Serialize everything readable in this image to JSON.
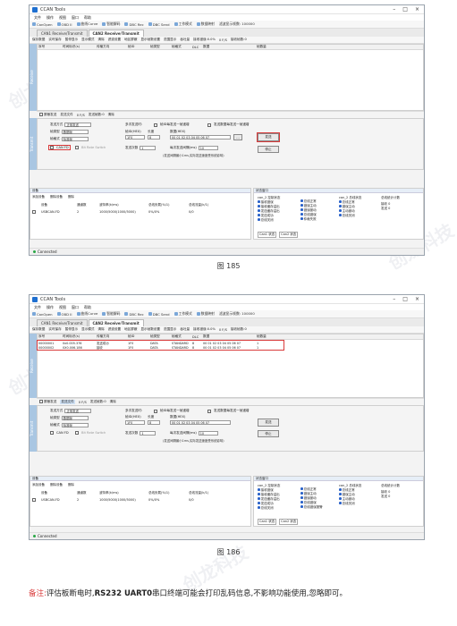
{
  "app": {
    "title": "CCAN Tools",
    "menu": [
      "文件",
      "操作",
      "视图",
      "窗口",
      "帮助"
    ],
    "toolbar": [
      "CanOpen",
      "OBD II",
      "曲线Curve",
      "智能解码",
      "DBC Rec",
      "DBC Send",
      "工作模式",
      "数据映射",
      "滤波显示帧数: 100000"
    ],
    "tabs": [
      "CAN1 Receive/Transmit",
      "CAN2 Receive/Transmit"
    ],
    "subtool": [
      "保存数据",
      "实时保存",
      "暂停显示",
      "显示模式",
      "清除",
      "滤波设置",
      "地区屏蔽",
      "显示帧数设置",
      "范围显示",
      "吞吐量",
      "数据移动",
      "接收错误:0.0%",
      "0 F/S",
      "接收帧数:0"
    ],
    "grid_label": "Receive",
    "grid_columns": [
      "序号",
      "时间标识(s)",
      "传输方向",
      "帧ID",
      "帧类型",
      "帧格式",
      "DLC",
      "数据",
      "帧数量"
    ],
    "grid_bar": [
      "屏蔽发送",
      "发送文件",
      "0 F/S",
      "发送帧数:0",
      "清除"
    ],
    "send": {
      "label": "Transmit",
      "send_mode_label": "发送方式",
      "send_mode": "正常发送",
      "frame_type_label": "帧类型",
      "frame_type": "数据帧",
      "frame_format_label": "帧格式",
      "frame_format": "标准帧",
      "canfd_label": "CAN FD",
      "brs_label": "Bit Rate Switch",
      "multi_label": "多次发送时:",
      "inc_id_label": "帧ID每发送一帧递增",
      "inc_data_label": "发送数据每发送一帧递增",
      "id_label": "帧ID(HEX)",
      "id_value": "1F0",
      "len_label": "长度",
      "len_value": "8",
      "data_label": "数据(HEX)",
      "data_value": "00 01 02 03 04 05 06 07",
      "count_label": "发送次数",
      "count_value": "1",
      "interval_label": "每次发送间隔(ms)",
      "interval_value": "10",
      "send_button": "发送",
      "stop_button": "停止",
      "hint": "(发送间隔最小1ms,实际发送速度受系统影响)"
    },
    "devices": {
      "title": "设备",
      "actions": [
        "添加设备",
        "删除设备",
        "删除"
      ],
      "columns": [
        "设备",
        "通道数",
        "波特率(k/ms)",
        "总线负载(%/1)",
        "总线流量(k/1)"
      ],
      "row": [
        "USBCAN-FD",
        "2",
        "1000/5000(1000/5000)",
        "0%/0%",
        "0/0"
      ]
    },
    "status": {
      "title": "状态窗口",
      "can2_state": "can_2 控制状态",
      "flags": [
        "接收错误",
        "接收缓存溢出",
        "发送缓存溢出",
        "发送成功",
        "总线关闭",
        "总线正常",
        "错误主动",
        "错误被动",
        "总线错误",
        "仲裁失败",
        "总线错误报警"
      ],
      "bus_state": "can_2 总线状态",
      "bus_flags": [
        "总线正常",
        "错误主动",
        "主动被动",
        "总线关闭"
      ],
      "counter_title": "总线统计计数",
      "recv_label": "接收",
      "recv_value": "0",
      "send_label": "发送",
      "send_value": "0",
      "tabs": [
        "Can1 状态",
        "Can2 状态"
      ]
    },
    "connected": "Connected"
  },
  "figure1": {
    "caption": "图 185"
  },
  "figure2": {
    "caption": "图 186",
    "rows": [
      [
        "00000001",
        "0x0.005.376",
        "发送成功",
        "1F0",
        "DATA",
        "STANDARD",
        "8",
        "00 01 02 03 04 05 06 07",
        "1"
      ],
      [
        "00000002",
        "0X0.006.186",
        "接收",
        "1F0",
        "DATA",
        "STANDARD",
        "8",
        "00 01 02 03 04 05 06 07",
        "1"
      ]
    ]
  },
  "remark": {
    "label": "备注:",
    "text1": "评估板断电时,",
    "bold": "RS232 UART0",
    "text2": "串口终端可能会打印乱码信息,不影响功能使用,忽略即可。"
  },
  "watermark": "创龙科技"
}
